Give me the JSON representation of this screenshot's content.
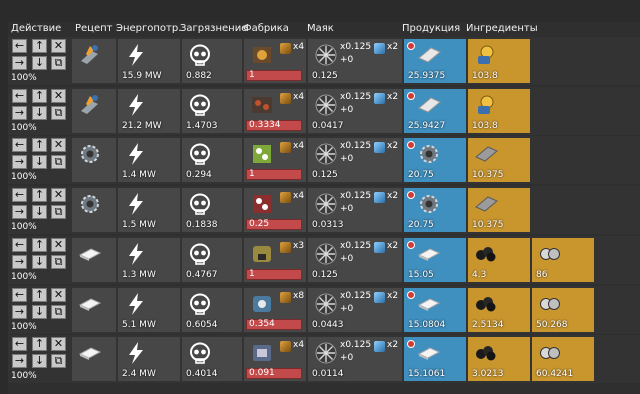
{
  "headers": {
    "action": "Действие",
    "recipe": "Рецепт",
    "energy": "Энергопотр.",
    "pollution": "Загрязнение",
    "factory": "Фабрика",
    "beacon": "Маяк",
    "products": "Продукция",
    "ingredients": "Ингредиенты"
  },
  "rows": [
    {
      "pct": "100%",
      "energy": "15.9 MW",
      "pollution": "0.882",
      "factory_mult": "x4",
      "factory_count": "1",
      "beacon_count": "0.125",
      "beacon_rate": "x0.125",
      "beacon_plus": "+0",
      "beacon_mult": "x2",
      "recipe_icon": "processing-unit-icon",
      "factory_icon": "assembler-icon",
      "products": [
        {
          "value": "25.9375",
          "icon": "plate-icon"
        }
      ],
      "ingredients": [
        {
          "value": "103.8",
          "icon": "fluid-barrel-icon"
        }
      ]
    },
    {
      "pct": "100%",
      "energy": "21.2 MW",
      "pollution": "1.4703",
      "factory_mult": "x4",
      "factory_count": "0.3334",
      "beacon_count": "0.0417",
      "beacon_rate": "x0.125",
      "beacon_plus": "+0",
      "beacon_mult": "x2",
      "recipe_icon": "processing-unit-icon",
      "factory_icon": "refinery-icon",
      "products": [
        {
          "value": "25.9427",
          "icon": "plate-icon"
        }
      ],
      "ingredients": [
        {
          "value": "103.8",
          "icon": "fluid-barrel-icon"
        }
      ]
    },
    {
      "pct": "100%",
      "energy": "1.4 MW",
      "pollution": "0.294",
      "factory_mult": "x4",
      "factory_count": "1",
      "beacon_count": "0.125",
      "beacon_rate": "x0.125",
      "beacon_plus": "+0",
      "beacon_mult": "x2",
      "recipe_icon": "gear-icon",
      "factory_icon": "green-assembler-icon",
      "products": [
        {
          "value": "20.75",
          "icon": "gear-icon"
        }
      ],
      "ingredients": [
        {
          "value": "10.375",
          "icon": "plate-icon"
        }
      ]
    },
    {
      "pct": "100%",
      "energy": "1.5 MW",
      "pollution": "0.1838",
      "factory_mult": "x4",
      "factory_count": "0.25",
      "beacon_count": "0.0313",
      "beacon_rate": "x0.125",
      "beacon_plus": "+0",
      "beacon_mult": "x2",
      "recipe_icon": "gear-icon",
      "factory_icon": "red-assembler-icon",
      "products": [
        {
          "value": "20.75",
          "icon": "gear-icon"
        }
      ],
      "ingredients": [
        {
          "value": "10.375",
          "icon": "plate-icon"
        }
      ]
    },
    {
      "pct": "100%",
      "energy": "1.3 MW",
      "pollution": "0.4767",
      "factory_mult": "x3",
      "factory_count": "1",
      "beacon_count": "0.125",
      "beacon_rate": "x0.125",
      "beacon_plus": "+0",
      "beacon_mult": "x2",
      "recipe_icon": "ingot-icon",
      "factory_icon": "furnace-icon",
      "products": [
        {
          "value": "15.05",
          "icon": "ingot-icon"
        }
      ],
      "ingredients": [
        {
          "value": "4.3",
          "icon": "coal-icon"
        },
        {
          "value": "86",
          "icon": "ore-icon"
        }
      ]
    },
    {
      "pct": "100%",
      "energy": "5.1 MW",
      "pollution": "0.6054",
      "factory_mult": "x8",
      "factory_count": "0.354",
      "beacon_count": "0.0443",
      "beacon_rate": "x0.125",
      "beacon_plus": "+0",
      "beacon_mult": "x2",
      "recipe_icon": "ingot-icon",
      "factory_icon": "electric-furnace-icon",
      "products": [
        {
          "value": "15.0804",
          "icon": "ingot-icon"
        }
      ],
      "ingredients": [
        {
          "value": "2.5134",
          "icon": "coal-icon"
        },
        {
          "value": "50.268",
          "icon": "ore-icon"
        }
      ]
    },
    {
      "pct": "100%",
      "energy": "2.4 MW",
      "pollution": "0.4014",
      "factory_mult": "x4",
      "factory_count": "0.091",
      "beacon_count": "0.0114",
      "beacon_rate": "x0.125",
      "beacon_plus": "+0",
      "beacon_mult": "x2",
      "recipe_icon": "ingot-icon",
      "factory_icon": "foundry-icon",
      "products": [
        {
          "value": "15.1061",
          "icon": "ingot-icon"
        }
      ],
      "ingredients": [
        {
          "value": "3.0213",
          "icon": "coal-icon"
        },
        {
          "value": "60.4241",
          "icon": "ore-icon"
        }
      ]
    }
  ],
  "colors": {
    "products_bg": "#3f8fbf",
    "ingredients_bg": "#c9962e",
    "factory_bar": "#c24a4a"
  }
}
